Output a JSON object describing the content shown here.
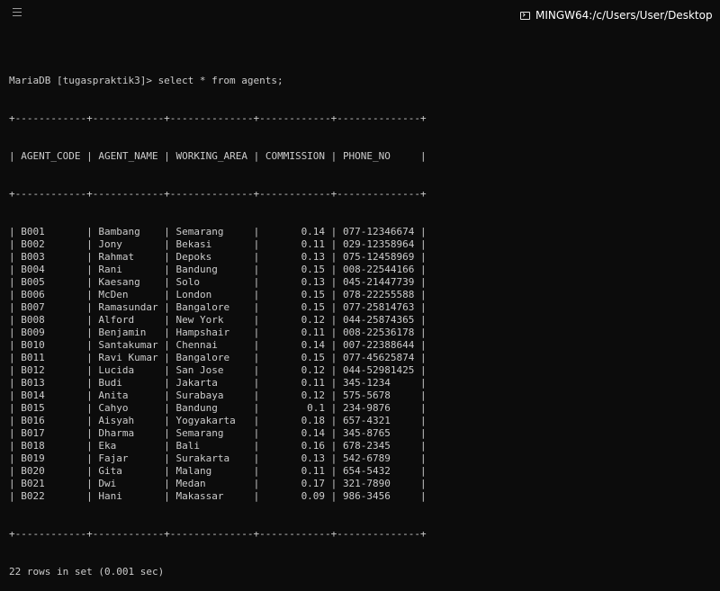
{
  "window": {
    "title": "MINGW64:/c/Users/User/Desktop",
    "menu_icon": "hamburger-menu-icon",
    "title_icon": "terminal-icon"
  },
  "terminal": {
    "prompt": "MariaDB [tugaspraktik3]> select * from agents;",
    "border_line": "+------------+------------+--------------+------------+--------------+",
    "columns": [
      "AGENT_CODE",
      "AGENT_NAME",
      "WORKING_AREA",
      "COMMISSION",
      "PHONE_NO"
    ],
    "rows": [
      [
        "B001",
        "Bambang",
        "Semarang",
        "0.14",
        "077-12346674"
      ],
      [
        "B002",
        "Jony",
        "Bekasi",
        "0.11",
        "029-12358964"
      ],
      [
        "B003",
        "Rahmat",
        "Depoks",
        "0.13",
        "075-12458969"
      ],
      [
        "B004",
        "Rani",
        "Bandung",
        "0.15",
        "008-22544166"
      ],
      [
        "B005",
        "Kaesang",
        "Solo",
        "0.13",
        "045-21447739"
      ],
      [
        "B006",
        "McDen",
        "London",
        "0.15",
        "078-22255588"
      ],
      [
        "B007",
        "Ramasundar",
        "Bangalore",
        "0.15",
        "077-25814763"
      ],
      [
        "B008",
        "Alford",
        "New York",
        "0.12",
        "044-25874365"
      ],
      [
        "B009",
        "Benjamin",
        "Hampshair",
        "0.11",
        "008-22536178"
      ],
      [
        "B010",
        "Santakumar",
        "Chennai",
        "0.14",
        "007-22388644"
      ],
      [
        "B011",
        "Ravi Kumar",
        "Bangalore",
        "0.15",
        "077-45625874"
      ],
      [
        "B012",
        "Lucida",
        "San Jose",
        "0.12",
        "044-52981425"
      ],
      [
        "B013",
        "Budi",
        "Jakarta",
        "0.11",
        "345-1234"
      ],
      [
        "B014",
        "Anita",
        "Surabaya",
        "0.12",
        "575-5678"
      ],
      [
        "B015",
        "Cahyo",
        "Bandung",
        "0.1",
        "234-9876"
      ],
      [
        "B016",
        "Aisyah",
        "Yogyakarta",
        "0.18",
        "657-4321"
      ],
      [
        "B017",
        "Dharma",
        "Semarang",
        "0.14",
        "345-8765"
      ],
      [
        "B018",
        "Eka",
        "Bali",
        "0.16",
        "678-2345"
      ],
      [
        "B019",
        "Fajar",
        "Surakarta",
        "0.13",
        "542-6789"
      ],
      [
        "B020",
        "Gita",
        "Malang",
        "0.11",
        "654-5432"
      ],
      [
        "B021",
        "Dwi",
        "Medan",
        "0.17",
        "321-7890"
      ],
      [
        "B022",
        "Hani",
        "Makassar",
        "0.09",
        "986-3456"
      ]
    ],
    "result_summary": "22 rows in set (0.001 sec)"
  },
  "colors": {
    "background": "#0c0c0c",
    "text": "#cccccc",
    "title_text": "#ffffff"
  }
}
